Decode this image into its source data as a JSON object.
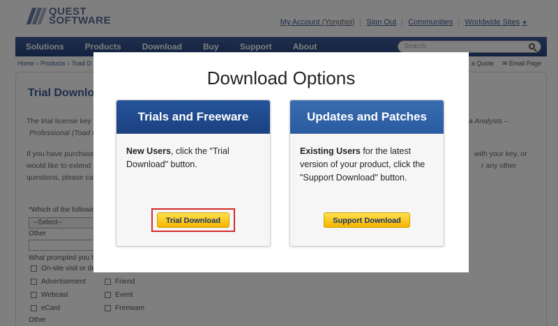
{
  "header": {
    "logo_line1": "QUEST",
    "logo_line2": "SOFTWARE",
    "my_account": "My Account",
    "account_user": "(Yonghoi)",
    "sign_out": "Sign Out",
    "communities": "Communities",
    "worldwide_sites": "Worldwide Sites"
  },
  "nav": {
    "items": [
      "Solutions",
      "Products",
      "Download",
      "Buy",
      "Support",
      "About"
    ],
    "search_placeholder": "Search"
  },
  "breadcrumb": [
    "Home",
    "Products",
    "Toad D"
  ],
  "util_links": [
    "a Quote",
    "Email Page"
  ],
  "background": {
    "heading": "Trial Downlo",
    "para1_line1": "The trial license key",
    "para1_line1_right": "a Analysts –",
    "para1_line2": "Professional (Toad fo",
    "para2_line1": "If you have purchased",
    "para2_line1_right": "with your key, or",
    "para2_line2": "would like to extend",
    "para2_line2_right": "r any other",
    "para2_line3": "questions, please ca",
    "question_label": "*Which of the followin",
    "select_value": "--Select--",
    "other_label": "Other",
    "prompt_label": "What prompted you to",
    "checkboxes_left": [
      "On-site visit or den",
      "Advertisement",
      "Webcast",
      "eCard"
    ],
    "checkboxes_right": [
      "Friend",
      "Event",
      "Freeware"
    ],
    "other_label2": "Other"
  },
  "modal": {
    "title": "Download Options",
    "left_card": {
      "header": "Trials and Freeware",
      "bold": "New Users",
      "text": ", click the \"Trial Download\" button.",
      "button": "Trial Download"
    },
    "right_card": {
      "header": "Updates and Patches",
      "bold": "Existing Users",
      "text": " for the latest version of your product, click the \"Support Download\" button.",
      "button": "Support Download"
    }
  }
}
